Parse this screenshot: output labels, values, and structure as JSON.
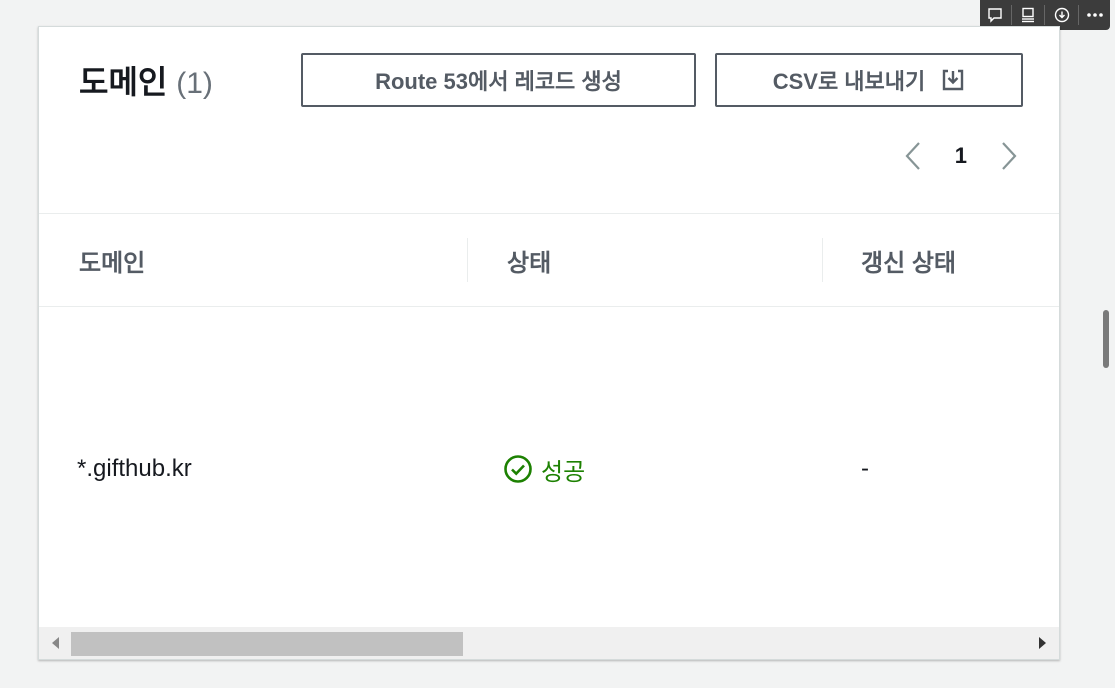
{
  "toolbar": {
    "icons": [
      "comment-icon",
      "layout-icon",
      "download-icon",
      "more-icon"
    ]
  },
  "panel": {
    "title": "도메인",
    "count": "(1)",
    "route53_button": "Route 53에서 레코드 생성",
    "csv_button": "CSV로 내보내기",
    "pagination": {
      "current_page": "1"
    }
  },
  "table": {
    "columns": [
      "도메인",
      "상태",
      "갱신 상태"
    ],
    "rows": [
      {
        "domain": "*.gifthub.kr",
        "status": "성공",
        "renewal_status": "-"
      }
    ]
  },
  "colors": {
    "success": "#1d8102",
    "text": "#16191f",
    "muted": "#545b64"
  }
}
